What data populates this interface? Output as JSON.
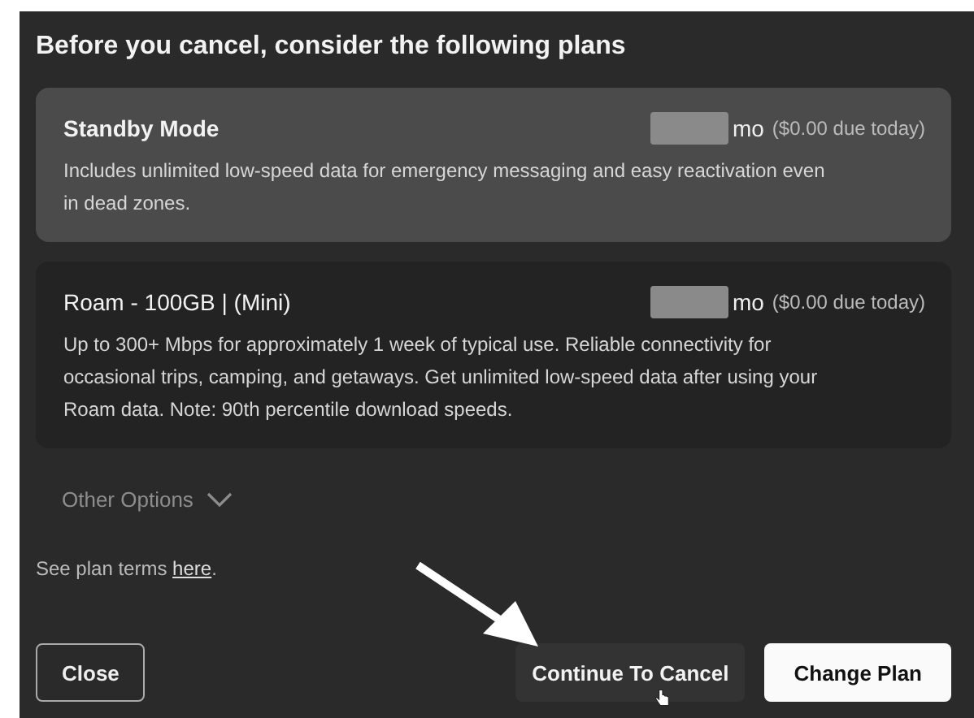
{
  "dialog": {
    "title": "Before you cancel, consider the following plans"
  },
  "plans": [
    {
      "name": "Standby Mode",
      "name_bold": true,
      "price_suffix": "mo",
      "due": "($0.00 due today)",
      "description": "Includes unlimited low-speed data for emergency messaging and easy reactivation even in dead zones.",
      "selected": true
    },
    {
      "name": "Roam - 100GB | (Mini)",
      "name_bold": false,
      "price_suffix": "mo",
      "due": "($0.00 due today)",
      "description": "Up to 300+ Mbps for approximately 1 week of typical use. Reliable connectivity for occasional trips, camping, and getaways. Get unlimited low-speed data after using your Roam data. Note: 90th percentile download speeds.",
      "selected": false
    }
  ],
  "other_options": {
    "label": "Other Options",
    "expanded": false
  },
  "terms": {
    "text": "See plan terms ",
    "link": "here",
    "end": "."
  },
  "buttons": [
    {
      "label": "Close",
      "kind": "outline"
    },
    {
      "label": "Continue To Cancel",
      "kind": "ghost"
    },
    {
      "label": "Change Plan",
      "kind": "primary"
    }
  ]
}
